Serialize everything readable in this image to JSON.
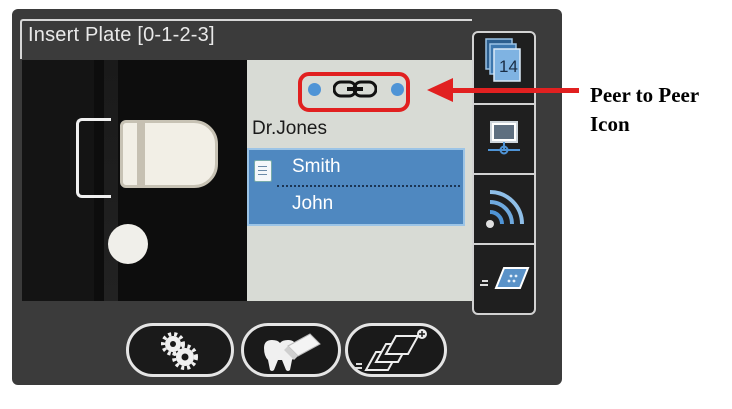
{
  "window": {
    "title": "Insert Plate [0-1-2-3]"
  },
  "patient_panel": {
    "doctor": "Dr.Jones",
    "patient": {
      "last_name": "Smith",
      "first_name": "John"
    }
  },
  "sidebar": {
    "counter": "14",
    "buttons": [
      "image-count-icon",
      "monitor-network-icon",
      "wifi-signal-icon",
      "scan-plate-icon"
    ]
  },
  "toolbar": {
    "buttons": [
      "settings-gears-icon",
      "tooth-eraser-icon",
      "add-plates-icon"
    ]
  },
  "annotation": {
    "line1": "Peer to Peer",
    "line2": "Icon",
    "color": "#e12020"
  },
  "colors": {
    "accent": "#4f88c0",
    "peer_dot": "#4f94d6"
  }
}
